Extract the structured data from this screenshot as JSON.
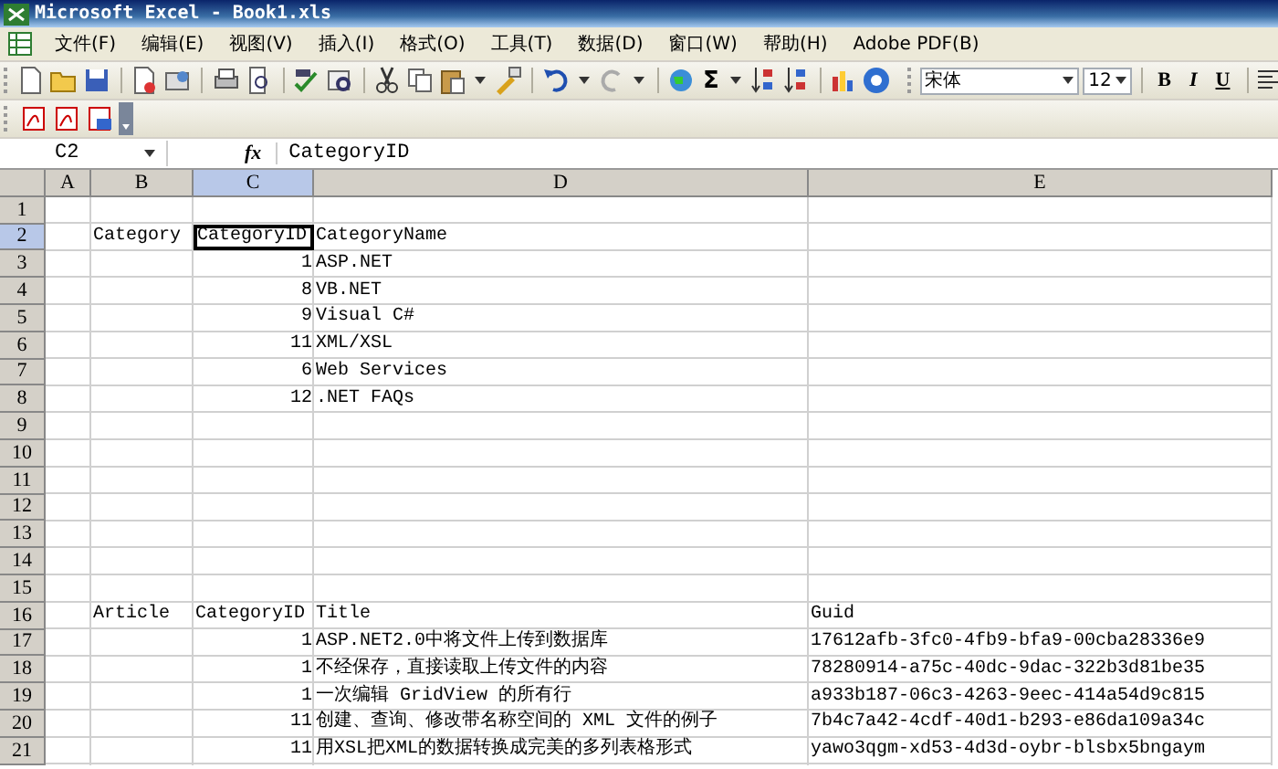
{
  "window": {
    "title": "Microsoft Excel - Book1.xls"
  },
  "menu": [
    "文件(F)",
    "编辑(E)",
    "视图(V)",
    "插入(I)",
    "格式(O)",
    "工具(T)",
    "数据(D)",
    "窗口(W)",
    "帮助(H)",
    "Adobe PDF(B)"
  ],
  "toolbar": {
    "autosum": "Σ",
    "font": "宋体",
    "font_size": "12",
    "bold": "B",
    "italic": "I",
    "underline": "U"
  },
  "formula_bar": {
    "name_box": "C2",
    "fx": "fx",
    "value": "CategoryID"
  },
  "columns": [
    {
      "label": "A",
      "selected": false
    },
    {
      "label": "B",
      "selected": false
    },
    {
      "label": "C",
      "selected": true
    },
    {
      "label": "D",
      "selected": false
    },
    {
      "label": "E",
      "selected": false
    }
  ],
  "rows": [
    {
      "label": "1",
      "selected": false,
      "cells": {}
    },
    {
      "label": "2",
      "selected": true,
      "cells": {
        "B": {
          "value": "Category",
          "kind": "text",
          "selected": false
        },
        "C": {
          "value": "CategoryID",
          "kind": "text",
          "selected": true
        },
        "D": {
          "value": "CategoryName",
          "kind": "text",
          "selected": false
        }
      }
    },
    {
      "label": "3",
      "selected": false,
      "cells": {
        "C": {
          "value": "1",
          "kind": "number",
          "selected": false
        },
        "D": {
          "value": "ASP.NET",
          "kind": "text",
          "selected": false
        }
      }
    },
    {
      "label": "4",
      "selected": false,
      "cells": {
        "C": {
          "value": "8",
          "kind": "number",
          "selected": false
        },
        "D": {
          "value": "VB.NET",
          "kind": "text",
          "selected": false
        }
      }
    },
    {
      "label": "5",
      "selected": false,
      "cells": {
        "C": {
          "value": "9",
          "kind": "number",
          "selected": false
        },
        "D": {
          "value": "Visual C#",
          "kind": "text",
          "selected": false
        }
      }
    },
    {
      "label": "6",
      "selected": false,
      "cells": {
        "C": {
          "value": "11",
          "kind": "number",
          "selected": false
        },
        "D": {
          "value": "XML/XSL",
          "kind": "text",
          "selected": false
        }
      }
    },
    {
      "label": "7",
      "selected": false,
      "cells": {
        "C": {
          "value": "6",
          "kind": "number",
          "selected": false
        },
        "D": {
          "value": "Web Services",
          "kind": "text",
          "selected": false
        }
      }
    },
    {
      "label": "8",
      "selected": false,
      "cells": {
        "C": {
          "value": "12",
          "kind": "number",
          "selected": false
        },
        "D": {
          "value": ".NET FAQs",
          "kind": "text",
          "selected": false
        }
      }
    },
    {
      "label": "9",
      "selected": false,
      "cells": {}
    },
    {
      "label": "10",
      "selected": false,
      "cells": {}
    },
    {
      "label": "11",
      "selected": false,
      "cells": {}
    },
    {
      "label": "12",
      "selected": false,
      "cells": {}
    },
    {
      "label": "13",
      "selected": false,
      "cells": {}
    },
    {
      "label": "14",
      "selected": false,
      "cells": {}
    },
    {
      "label": "15",
      "selected": false,
      "cells": {}
    },
    {
      "label": "16",
      "selected": false,
      "cells": {
        "B": {
          "value": "Article",
          "kind": "text",
          "selected": false
        },
        "C": {
          "value": "CategoryID",
          "kind": "text",
          "selected": false
        },
        "D": {
          "value": "Title",
          "kind": "text",
          "selected": false
        },
        "E": {
          "value": "Guid",
          "kind": "text",
          "selected": false
        }
      }
    },
    {
      "label": "17",
      "selected": false,
      "cells": {
        "C": {
          "value": "1",
          "kind": "number",
          "selected": false
        },
        "D": {
          "value": "ASP.NET2.0中将文件上传到数据库",
          "kind": "text",
          "selected": false
        },
        "E": {
          "value": "17612afb-3fc0-4fb9-bfa9-00cba28336e9",
          "kind": "text",
          "selected": false
        }
      }
    },
    {
      "label": "18",
      "selected": false,
      "cells": {
        "C": {
          "value": "1",
          "kind": "number",
          "selected": false
        },
        "D": {
          "value": "不经保存，直接读取上传文件的内容",
          "kind": "text",
          "selected": false
        },
        "E": {
          "value": "78280914-a75c-40dc-9dac-322b3d81be35",
          "kind": "text",
          "selected": false
        }
      }
    },
    {
      "label": "19",
      "selected": false,
      "cells": {
        "C": {
          "value": "1",
          "kind": "number",
          "selected": false
        },
        "D": {
          "value": "一次编辑 GridView 的所有行",
          "kind": "text",
          "selected": false
        },
        "E": {
          "value": "a933b187-06c3-4263-9eec-414a54d9c815",
          "kind": "text",
          "selected": false
        }
      }
    },
    {
      "label": "20",
      "selected": false,
      "cells": {
        "C": {
          "value": "11",
          "kind": "number",
          "selected": false
        },
        "D": {
          "value": "创建、查询、修改带名称空间的 XML 文件的例子",
          "kind": "text",
          "selected": false
        },
        "E": {
          "value": "7b4c7a42-4cdf-40d1-b293-e86da109a34c",
          "kind": "text",
          "selected": false
        }
      }
    },
    {
      "label": "21",
      "selected": false,
      "cells": {
        "C": {
          "value": "11",
          "kind": "number",
          "selected": false
        },
        "D": {
          "value": "用XSL把XML的数据转换成完美的多列表格形式",
          "kind": "text",
          "selected": false
        },
        "E": {
          "value": "yawo3qgm-xd53-4d3d-oybr-blsbx5bngaym",
          "kind": "text",
          "selected": false
        }
      }
    }
  ]
}
